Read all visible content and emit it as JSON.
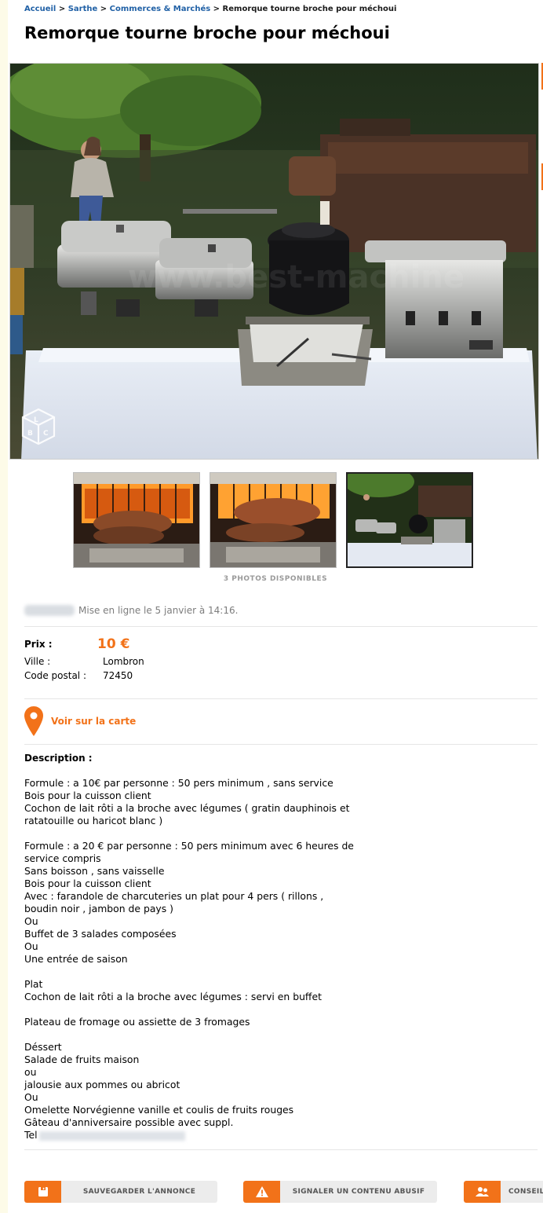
{
  "breadcrumb": {
    "items": [
      "Accueil",
      "Sarthe",
      "Commerces & Marchés"
    ],
    "separator": ">",
    "current": "Remorque tourne broche pour méchoui"
  },
  "ad": {
    "title": "Remorque tourne broche pour méchoui",
    "photos_available": "3 PHOTOS DISPONIBLES",
    "posted": "Mise en ligne le 5 janvier à 14:16.",
    "price_label": "Prix :",
    "price_value": "10 €",
    "city_label": "Ville :",
    "city_value": "Lombron",
    "postal_label": "Code postal :",
    "postal_value": "72450",
    "map_link": "Voir sur la carte",
    "description_title": "Description :",
    "description_lines": [
      "Formule : a 10€ par personne : 50 pers minimum , sans service",
      "Bois pour la cuisson client",
      "Cochon de lait rôti a la broche avec légumes ( gratin dauphinois et",
      "ratatouille ou haricot blanc )",
      "",
      "Formule : a 20 € par personne : 50 pers minimum avec 6 heures de",
      "service compris",
      "Sans boisson , sans vaisselle",
      "Bois pour la cuisson client",
      "Avec : farandole de charcuteries un plat pour 4 pers ( rillons ,",
      "boudin noir , jambon de pays )",
      "Ou",
      "Buffet de 3 salades composées",
      "Ou",
      "Une entrée de saison",
      "",
      "Plat",
      "Cochon de lait rôti a la broche avec légumes : servi en buffet",
      "",
      "Plateau de fromage ou assiette de 3 fromages",
      "",
      "Déssert",
      "Salade de fruits maison",
      "ou",
      "jalousie aux pommes ou abricot",
      "Ou",
      "Omelette Norvégienne vanille et coulis de fruits rouges",
      "Gâteau d'anniversaire possible avec suppl."
    ],
    "phone_prefix": "Tel"
  },
  "actions": {
    "save": "SAUVEGARDER L'ANNONCE",
    "report": "SIGNALER UN CONTENU ABUSIF",
    "advice": "CONSEILS"
  },
  "icons": {
    "save": "floppy-disk-icon",
    "report": "warning-icon",
    "advice": "people-icon",
    "map": "map-pin-icon",
    "watermark": "lbc-cube-logo"
  },
  "colors": {
    "accent": "#f27219",
    "link": "#2161a6",
    "background": "#fdfbe8"
  }
}
